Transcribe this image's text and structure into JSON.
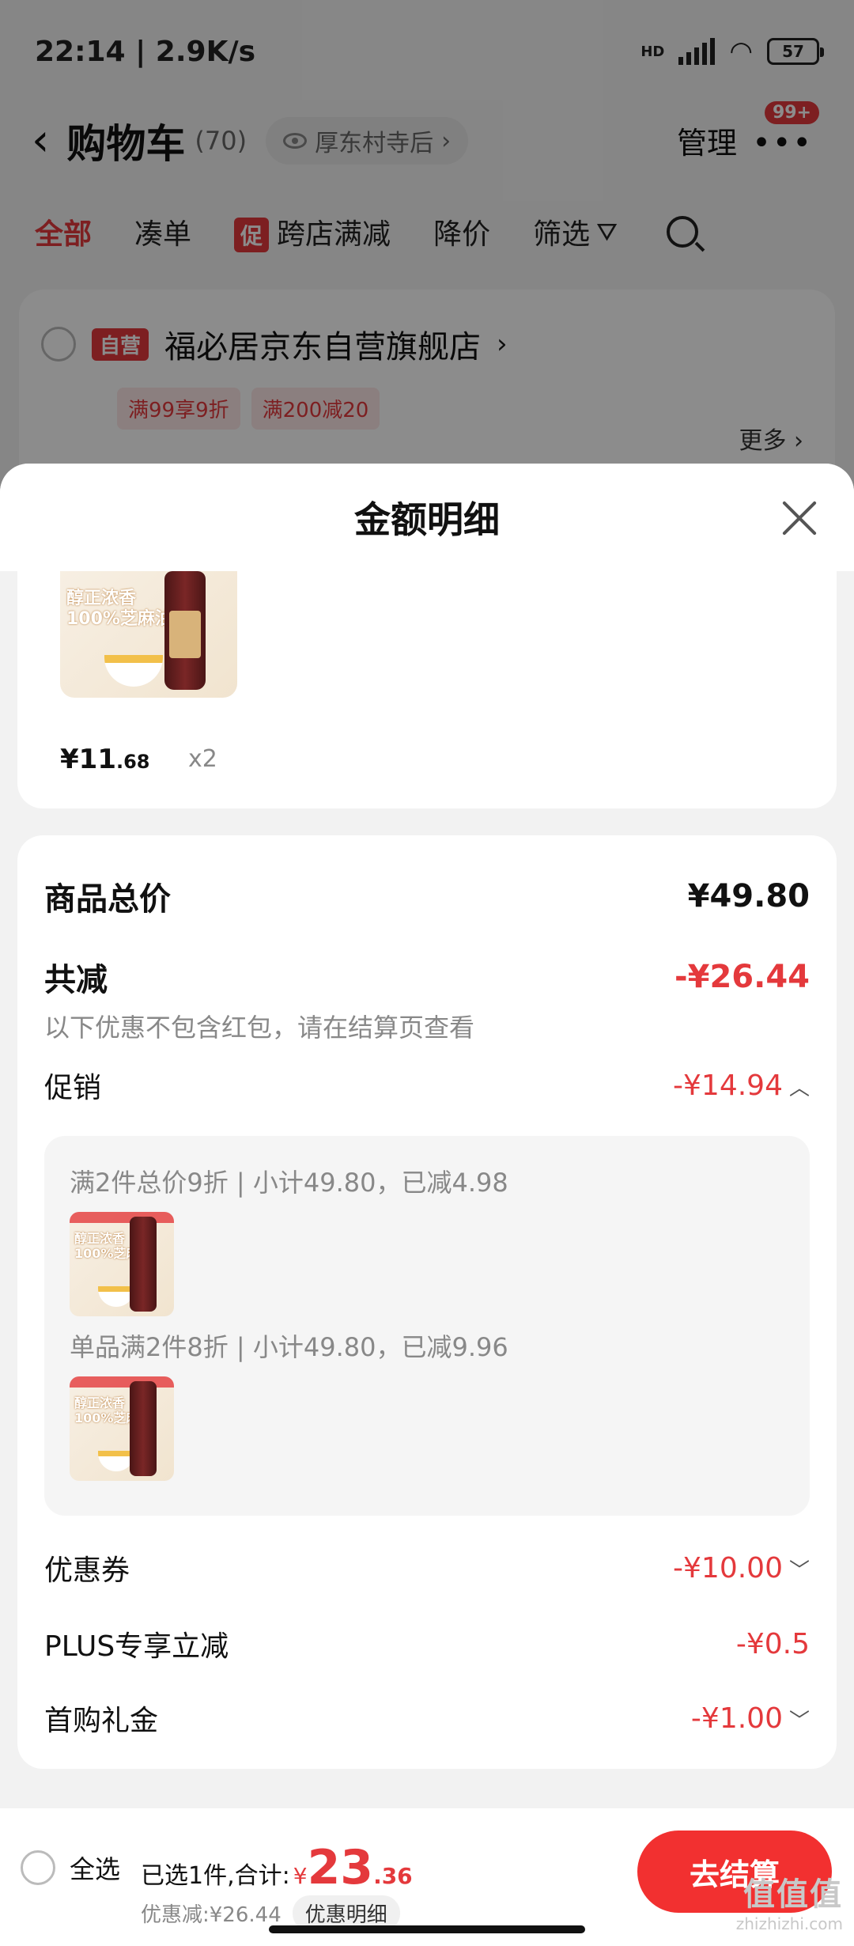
{
  "status_bar": {
    "time_speed": "22:14 | 2.9K/s",
    "network": "HD",
    "battery": "57"
  },
  "cart_header": {
    "title": "购物车",
    "count": "(70)",
    "location": "厚东村寺后",
    "manage": "管理",
    "badge": "99+"
  },
  "filter_tabs": {
    "all": "全部",
    "add_on": "凑单",
    "promo_tag": "促",
    "cross_store": "跨店满减",
    "price_drop": "降价",
    "filter": "筛选"
  },
  "store": {
    "self_tag": "自营",
    "name": "福必居京东自营旗舰店",
    "coupons": [
      "满99享9折",
      "满200减20"
    ],
    "more": "更多"
  },
  "sheet": {
    "title": "金额明细",
    "product": {
      "thumb_text_line1": "醇正浓香",
      "thumb_text_line2": "100%芝麻油",
      "price_int": "¥11",
      "price_dec": ".68",
      "qty": "x2"
    },
    "total": {
      "label": "商品总价",
      "value": "¥49.80"
    },
    "reduction": {
      "label": "共减",
      "value": "-¥26.44",
      "note": "以下优惠不包含红包，请在结算页查看"
    },
    "promo": {
      "label": "促销",
      "value": "-¥14.94",
      "items": [
        {
          "text": "满2件总价9折 | 小计49.80，已减4.98"
        },
        {
          "text": "单品满2件8折 | 小计49.80，已减9.96"
        }
      ]
    },
    "coupon": {
      "label": "优惠券",
      "value": "-¥10.00"
    },
    "plus": {
      "label": "PLUS专享立减",
      "value": "-¥0.5"
    },
    "first_buy": {
      "label": "首购礼金",
      "value": "-¥1.00"
    }
  },
  "bottom_bar": {
    "select_all": "全选",
    "selected_text": "已选1件,合计:",
    "currency": "¥",
    "total_int": "23",
    "total_dec": ".36",
    "discount_text": "优惠减:¥26.44",
    "detail_chip": "优惠明细",
    "checkout": "去结算"
  },
  "watermark": {
    "main": "值值值",
    "sub": "zhizhizhi.com"
  },
  "colors": {
    "accent": "#e4393c",
    "checkout": "#f23030"
  }
}
